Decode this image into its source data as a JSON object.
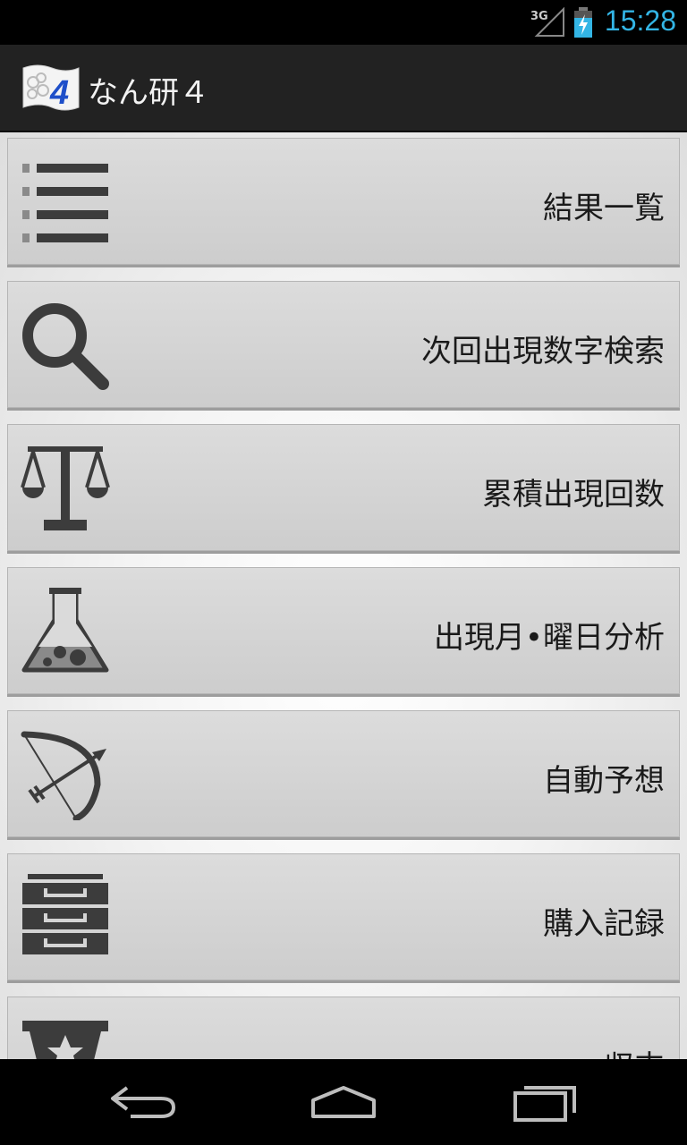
{
  "status_bar": {
    "network_label": "3G",
    "time": "15:28",
    "accent_color": "#33b5e5"
  },
  "action_bar": {
    "logo_icon": "flag-four-logo",
    "logo_digit": "4",
    "title": "なん研４"
  },
  "menu": {
    "items": [
      {
        "label": "結果一覧",
        "icon": "list-icon"
      },
      {
        "label": "次回出現数字検索",
        "icon": "magnifier-icon"
      },
      {
        "label": "累積出現回数",
        "icon": "scales-icon"
      },
      {
        "label": "出現月•曜日分析",
        "icon": "flask-icon"
      },
      {
        "label": "自動予想",
        "icon": "bow-arrow-icon"
      },
      {
        "label": "購入記録",
        "icon": "cabinet-icon"
      },
      {
        "label": "収支",
        "icon": "trophy-icon"
      }
    ]
  },
  "nav_bar": {
    "buttons": [
      "back-icon",
      "home-icon",
      "recent-apps-icon"
    ]
  }
}
